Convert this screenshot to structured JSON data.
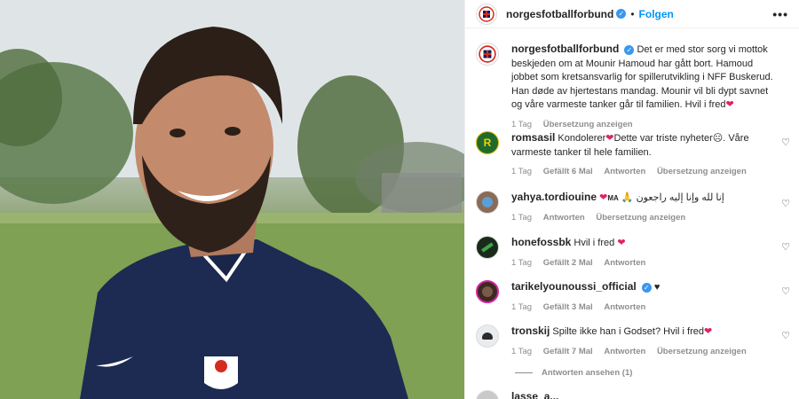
{
  "post": {
    "username": "norgesfotballforbund",
    "follow_label": "Folgen",
    "more_icon": "more-icon",
    "caption": "Det er med stor sorg vi mottok beskjeden om at Mounir Hamoud har gått bort. Hamoud jobbet som kretsansvarlig for spillerutvikling i NFF Buskerud. Han døde av hjertestans mandag. Mounir vil bli dypt savnet og våre varmeste tanker går til familien. Hvil i fred",
    "caption_time": "1 Tag",
    "caption_translate": "Übersetzung anzeigen",
    "logo_text": "NFF"
  },
  "comments": [
    {
      "username": "romsasil",
      "text_a": "Kondolerer",
      "text_b": "Dette var triste nyheter",
      "text_c": ". Våre varmeste tanker til hele familien.",
      "time": "1 Tag",
      "likes": "Gefällt 6 Mal",
      "reply": "Antworten",
      "translate": "Übersetzung anzeigen"
    },
    {
      "username": "yahya.tordiouine",
      "text": "إنا لله وإنا إليه راجعون",
      "suffix": "MA",
      "time": "1 Tag",
      "reply": "Antworten",
      "translate": "Übersetzung anzeigen"
    },
    {
      "username": "honefossbk",
      "text": "Hvil i fred",
      "time": "1 Tag",
      "likes": "Gefällt 2 Mal",
      "reply": "Antworten"
    },
    {
      "username": "tarikelyounoussi_official",
      "time": "1 Tag",
      "likes": "Gefällt 3 Mal",
      "reply": "Antworten"
    },
    {
      "username": "tronskij",
      "text": "Spilte ikke han i Godset? Hvil i fred",
      "time": "1 Tag",
      "likes": "Gefällt 7 Mal",
      "reply": "Antworten",
      "translate": "Übersetzung anzeigen",
      "view_replies": "Antworten ansehen (1)"
    }
  ],
  "partial_username": "lasse_a...",
  "colors": {
    "accent": "#0095f6",
    "heart": "#e0245e",
    "muted": "#8e8e8e"
  }
}
